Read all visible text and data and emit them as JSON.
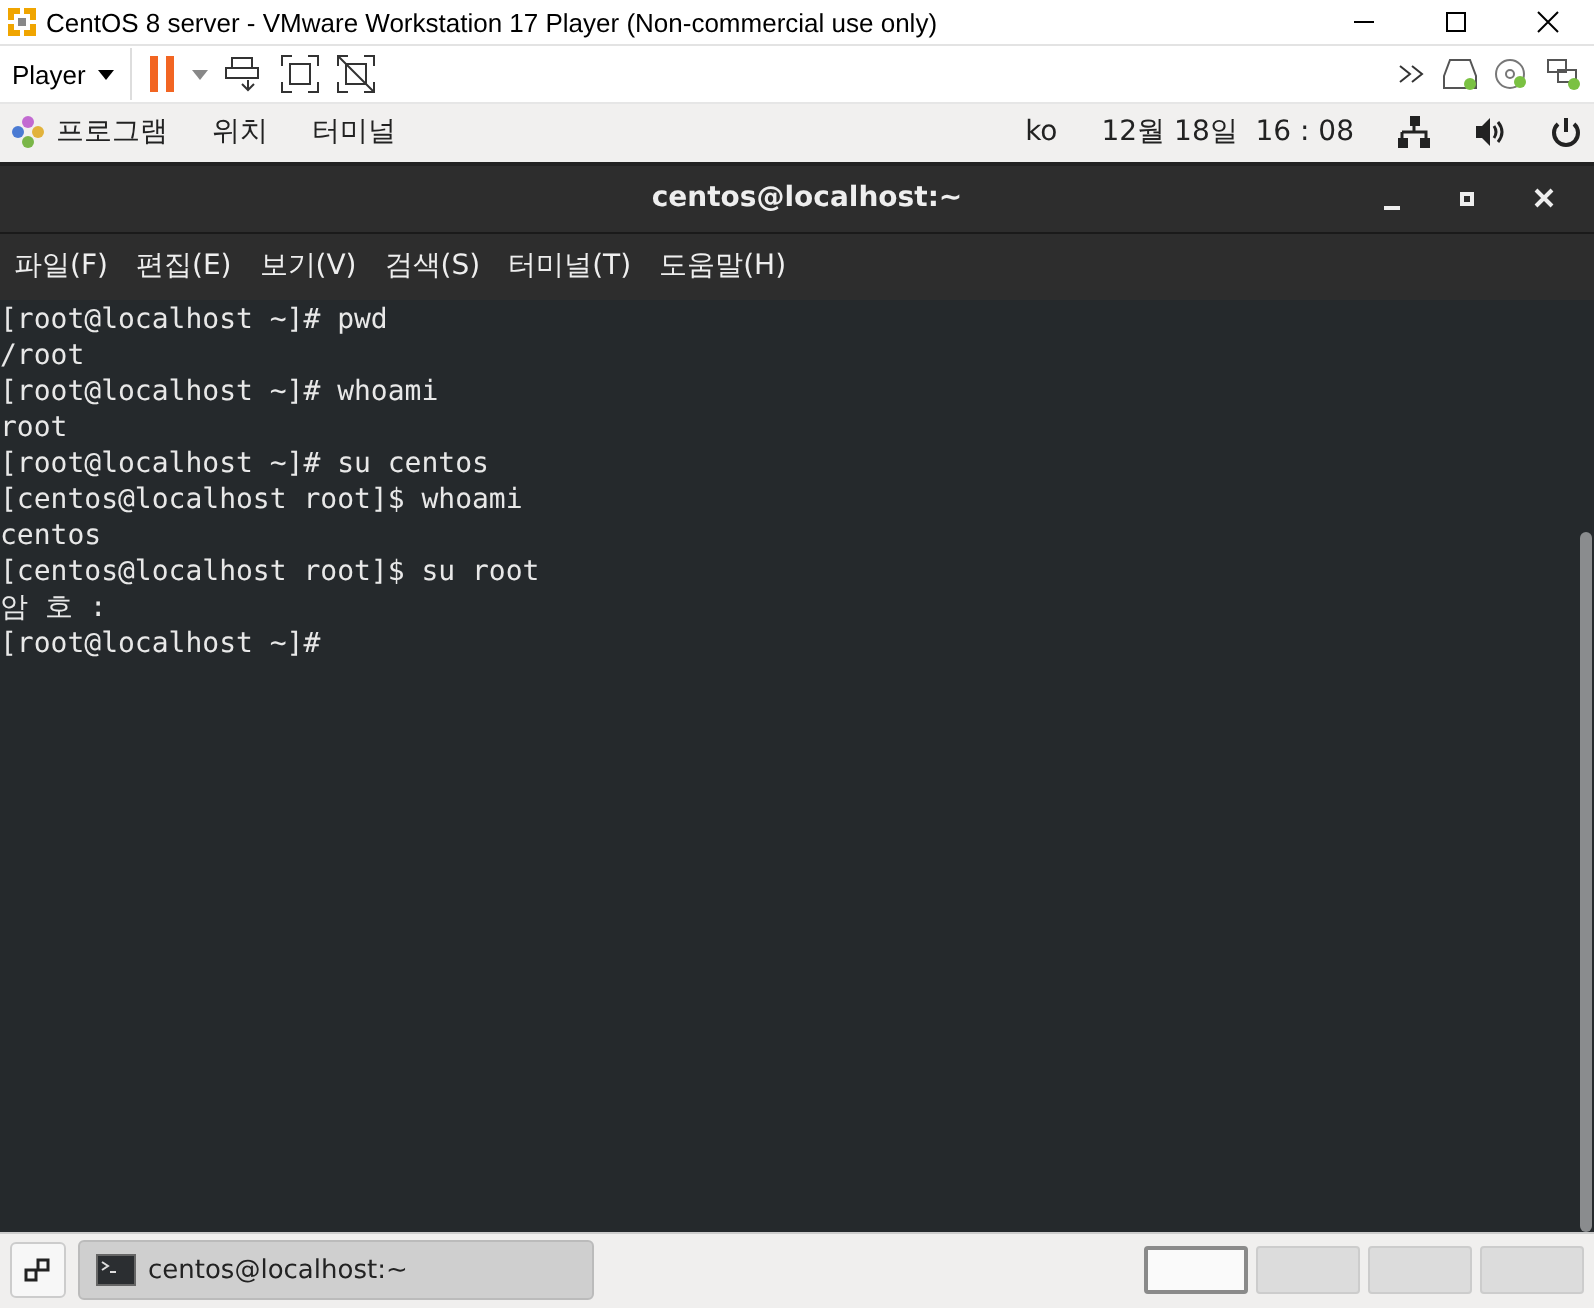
{
  "window": {
    "title": "CentOS 8 server - VMware Workstation 17 Player (Non-commercial use only)"
  },
  "toolbar": {
    "player_menu": "Player"
  },
  "top_bar": {
    "menus": [
      "프로그램",
      "위치",
      "터미널"
    ],
    "input_method": "ko",
    "clock": "12월 18일  16 : 08"
  },
  "terminal": {
    "title": "centos@localhost:~",
    "menu": [
      "파일(F)",
      "편집(E)",
      "보기(V)",
      "검색(S)",
      "터미널(T)",
      "도움말(H)"
    ],
    "lines": [
      "[root@localhost ~]# pwd",
      "/root",
      "[root@localhost ~]# whoami",
      "root",
      "[root@localhost ~]# su centos",
      "[centos@localhost root]$ whoami",
      "centos",
      "[centos@localhost root]$ su root",
      "암 호 :",
      "[root@localhost ~]#"
    ]
  },
  "taskbar": {
    "window_button": "centos@localhost:~",
    "workspaces": [
      {
        "selected": true
      },
      {
        "selected": false
      },
      {
        "selected": false
      },
      {
        "selected": false
      }
    ]
  }
}
